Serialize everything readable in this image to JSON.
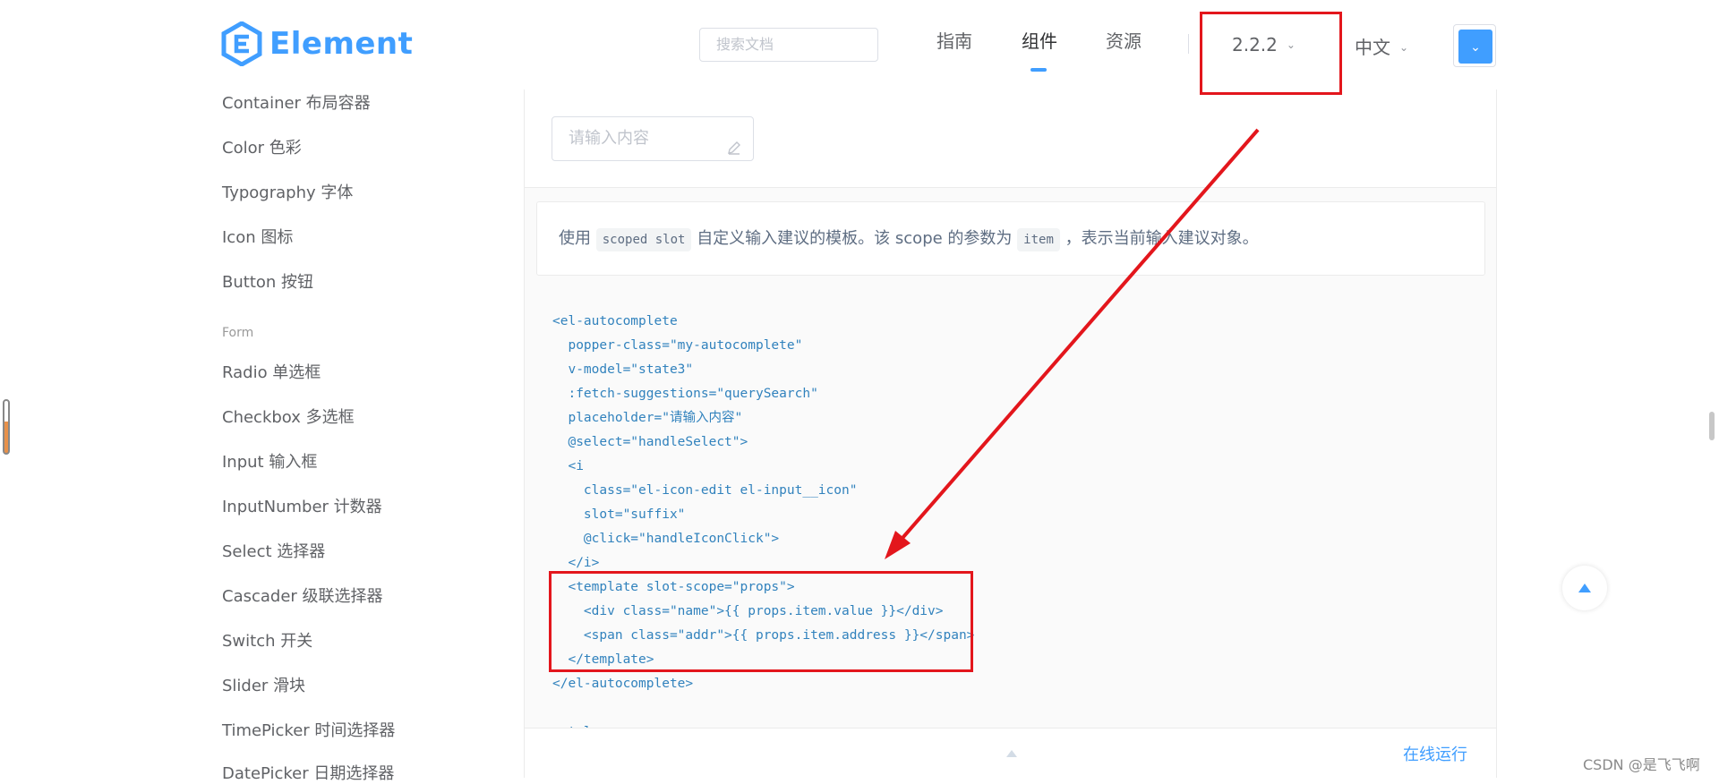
{
  "header": {
    "logo_text": "Element",
    "search_placeholder": "搜索文档",
    "nav": [
      "指南",
      "组件",
      "资源"
    ],
    "active_nav": "组件",
    "version": "2.2.2",
    "language": "中文"
  },
  "sidebar": {
    "items_top": [
      "Container 布局容器",
      "Color 色彩",
      "Typography 字体",
      "Icon 图标",
      "Button 按钮"
    ],
    "group_label": "Form",
    "items_form": [
      "Radio 单选框",
      "Checkbox 多选框",
      "Input 输入框",
      "InputNumber 计数器",
      "Select 选择器",
      "Cascader 级联选择器",
      "Switch 开关",
      "Slider 滑块",
      "TimePicker 时间选择器",
      "DatePicker 日期选择器"
    ]
  },
  "demo": {
    "input_placeholder": "请输入内容",
    "description": {
      "prefix": "使用",
      "code1": "scoped slot",
      "middle": "自定义输入建议的模板。该 scope 的参数为",
      "code2": "item",
      "suffix": "，表示当前输入建议对象。"
    },
    "code_lines": [
      "<el-autocomplete",
      "  popper-class=\"my-autocomplete\"",
      "  v-model=\"state3\"",
      "  :fetch-suggestions=\"querySearch\"",
      "  placeholder=\"请输入内容\"",
      "  @select=\"handleSelect\">",
      "  <i",
      "    class=\"el-icon-edit el-input__icon\"",
      "    slot=\"suffix\"",
      "    @click=\"handleIconClick\">",
      "  </i>",
      "  <template slot-scope=\"props\">",
      "    <div class=\"name\">{{ props.item.value }}</div>",
      "    <span class=\"addr\">{{ props.item.address }}</span>",
      "  </template>",
      "</el-autocomplete>",
      "",
      "<style>"
    ],
    "run_online": "在线运行"
  },
  "watermark": "CSDN @是飞飞啊",
  "colors": {
    "accent": "#409EFF",
    "annotation_red": "#e3161c"
  }
}
